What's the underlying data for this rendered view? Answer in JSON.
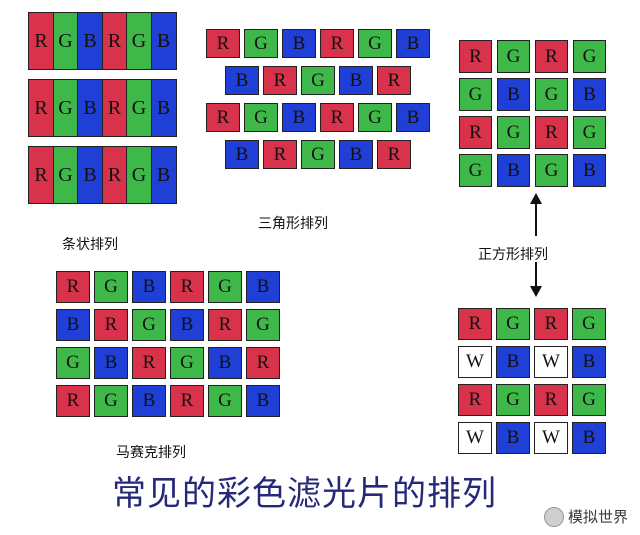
{
  "colors": {
    "R": "#d8334a",
    "G": "#3fb84a",
    "B": "#1f3fd6",
    "W": "#ffffff"
  },
  "diagrams": {
    "stripe": {
      "label": "条状排列",
      "columns": [
        "R",
        "G",
        "B",
        "R",
        "G",
        "B"
      ],
      "rows": 3
    },
    "triangle": {
      "label": "三角形排列",
      "rows": [
        [
          "R",
          "G",
          "B",
          "R",
          "G",
          "B"
        ],
        [
          "B",
          "R",
          "G",
          "B",
          "R"
        ],
        [
          "R",
          "G",
          "B",
          "R",
          "G",
          "B"
        ],
        [
          "B",
          "R",
          "G",
          "B",
          "R"
        ]
      ]
    },
    "square": {
      "label": "正方形排列",
      "rows": [
        [
          "R",
          "G",
          "R",
          "G"
        ],
        [
          "G",
          "B",
          "G",
          "B"
        ],
        [
          "R",
          "G",
          "R",
          "G"
        ],
        [
          "G",
          "B",
          "G",
          "B"
        ]
      ]
    },
    "square_w": {
      "rows": [
        [
          "R",
          "G",
          "R",
          "G"
        ],
        [
          "W",
          "B",
          "W",
          "B"
        ],
        [
          "R",
          "G",
          "R",
          "G"
        ],
        [
          "W",
          "B",
          "W",
          "B"
        ]
      ]
    },
    "mosaic": {
      "label": "马赛克排列",
      "rows": [
        [
          "R",
          "G",
          "B",
          "R",
          "G",
          "B"
        ],
        [
          "B",
          "R",
          "G",
          "B",
          "R",
          "G"
        ],
        [
          "G",
          "B",
          "R",
          "G",
          "B",
          "R"
        ],
        [
          "R",
          "G",
          "B",
          "R",
          "G",
          "B"
        ]
      ]
    }
  },
  "title": "常见的彩色滤光片的排列",
  "watermark": "模拟世界"
}
